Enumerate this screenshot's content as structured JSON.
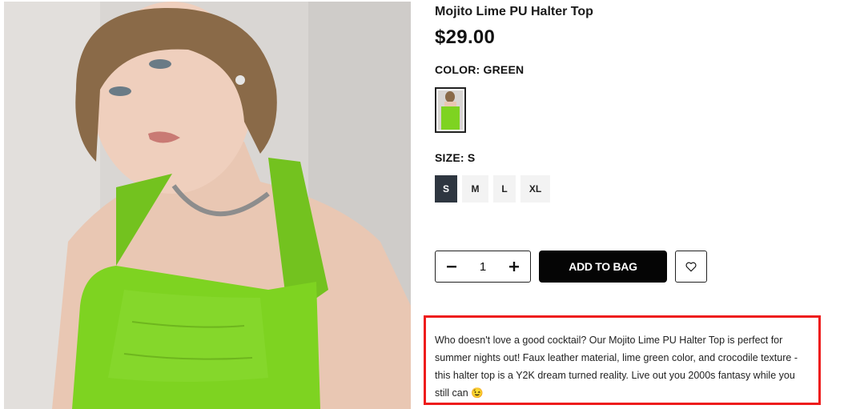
{
  "product": {
    "title": "Mojito Lime PU Halter Top",
    "price": "$29.00",
    "color_label": "COLOR: GREEN",
    "size_label": "SIZE: S",
    "sizes": [
      "S",
      "M",
      "L",
      "XL"
    ],
    "selected_size": "S",
    "quantity": "1",
    "add_to_bag_label": "ADD TO BAG",
    "description": "Who doesn't love a good cocktail? Our Mojito Lime PU Halter Top is perfect for summer nights out! Faux leather material, lime green color, and crocodile texture - this halter top is a Y2K dream turned reality. Live out you 2000s fantasy while you still can 😉"
  },
  "colors": {
    "accent_dark": "#050505",
    "selected_size_bg": "#2e3640",
    "highlight_border": "#ee1c1c",
    "product_green": "#7ed321"
  },
  "icons": {
    "minus": "minus-icon",
    "plus": "plus-icon",
    "wishlist": "heart-outline-icon"
  }
}
